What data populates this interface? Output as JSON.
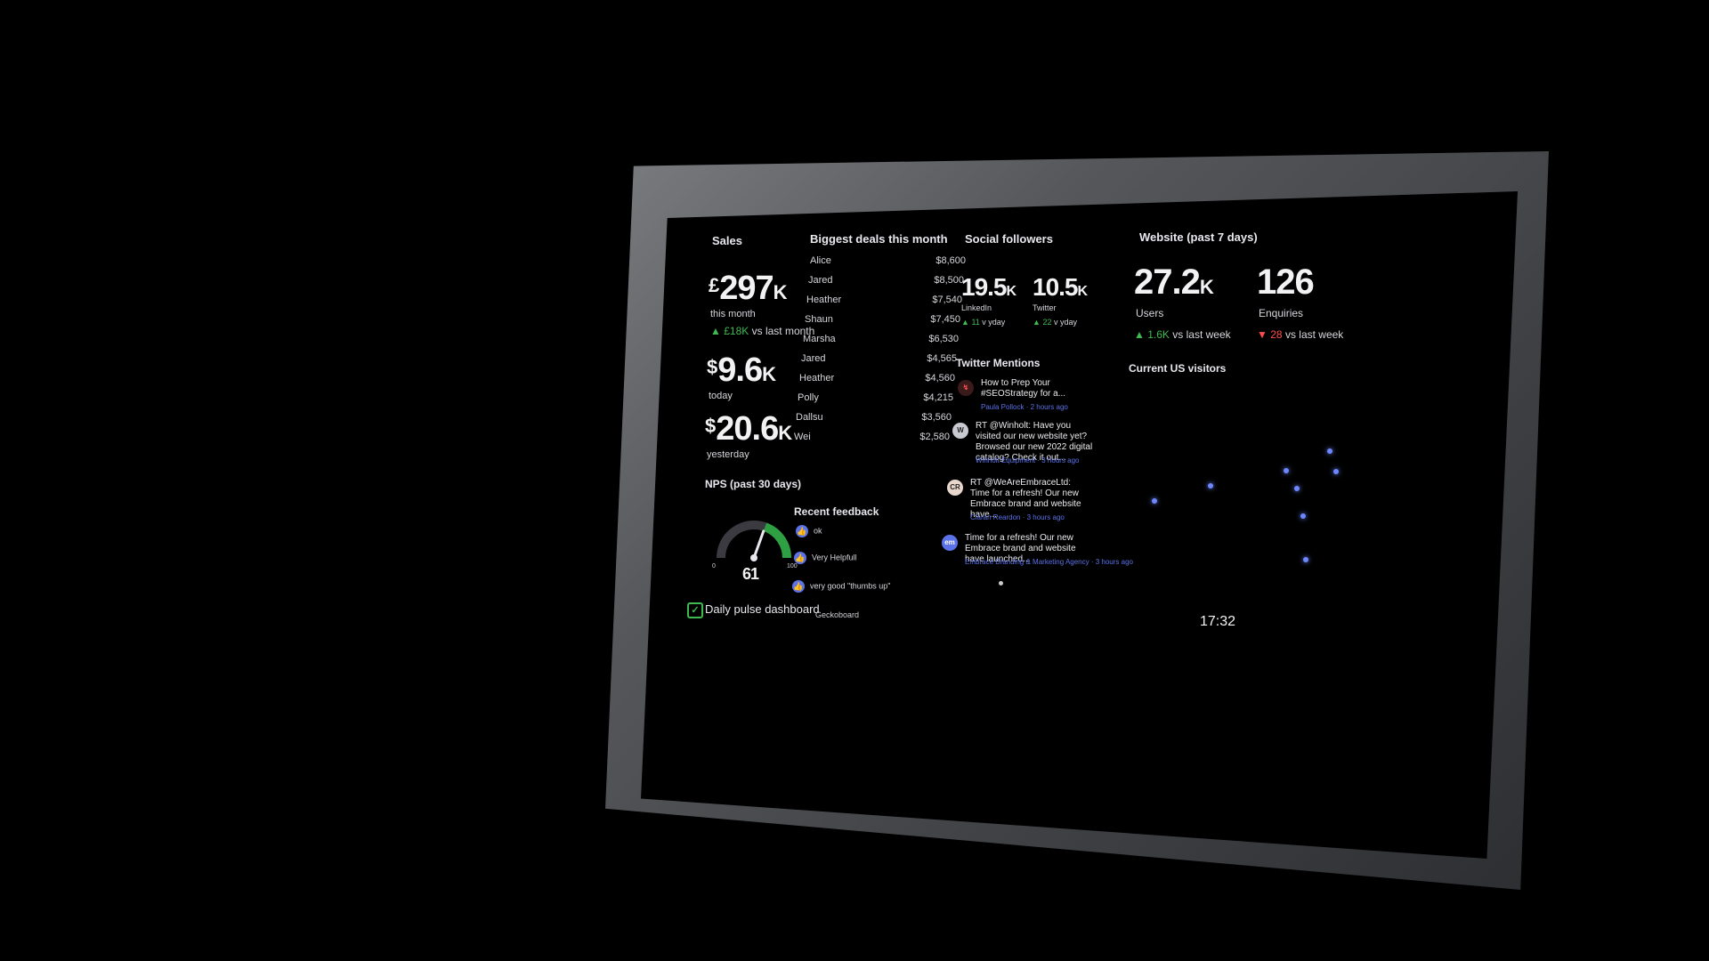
{
  "sales": {
    "title": "Sales",
    "month": {
      "currency": "£",
      "value": "297",
      "unit": "K",
      "label": "this month"
    },
    "month_delta": {
      "value": "£18K",
      "label": "vs last month"
    },
    "today": {
      "currency": "$",
      "value": "9.6",
      "unit": "K",
      "label": "today"
    },
    "yesterday": {
      "currency": "$",
      "value": "20.6",
      "unit": "K",
      "label": "yesterday"
    }
  },
  "nps": {
    "title": "NPS (past 30 days)",
    "value": "61",
    "min": "0",
    "max": "100",
    "level": 0.61
  },
  "deals": {
    "title": "Biggest deals this month",
    "rows": [
      {
        "name": "Alice",
        "value": "$8,600"
      },
      {
        "name": "Jared",
        "value": "$8,500"
      },
      {
        "name": "Heather",
        "value": "$7,540"
      },
      {
        "name": "Shaun",
        "value": "$7,450"
      },
      {
        "name": "Marsha",
        "value": "$6,530"
      },
      {
        "name": "Jared",
        "value": "$4,565"
      },
      {
        "name": "Heather",
        "value": "$4,560"
      },
      {
        "name": "Polly",
        "value": "$4,215"
      },
      {
        "name": "Dallsu",
        "value": "$3,560"
      },
      {
        "name": "Wei",
        "value": "$2,580"
      }
    ]
  },
  "feedback": {
    "title": "Recent feedback",
    "items": [
      "ok",
      "Very Helpfull",
      "very good \"thumbs up\""
    ]
  },
  "social": {
    "title": "Social followers",
    "linkedin": {
      "value": "19.5",
      "unit": "K",
      "label": "LinkedIn",
      "delta": "11",
      "delta_label": "v yday"
    },
    "twitter": {
      "value": "10.5",
      "unit": "K",
      "label": "Twitter",
      "delta": "22",
      "delta_label": "v yday"
    }
  },
  "mentions": {
    "title": "Twitter Mentions",
    "tweets": [
      {
        "text": "How to Prep Your #SEOStrategy for a...",
        "meta": "Paula Pollock · 2 hours ago"
      },
      {
        "text": "RT @Winholt: Have you visited our new website yet? Browsed our new 2022 digital catalog? Check it out...",
        "meta": "Winholt Equipment · 3 hours ago"
      },
      {
        "text": "RT @WeAreEmbraceLtd: Time for a refresh! Our new Embrace brand and website have...",
        "meta": "Ciaran Reardon · 3 hours ago"
      },
      {
        "text": "Time for a refresh! Our new Embrace brand and website have launched...",
        "meta": "Embrace Branding & Marketing Agency · 3 hours ago",
        "avatar": "em"
      }
    ]
  },
  "website": {
    "title": "Website (past 7 days)",
    "users": {
      "value": "27.2",
      "unit": "K",
      "label": "Users",
      "delta": "1.6K",
      "delta_label": "vs last week"
    },
    "enquiries": {
      "value": "126",
      "label": "Enquiries",
      "delta": "28",
      "delta_label": "vs last week"
    }
  },
  "visitors": {
    "title": "Current US visitors"
  },
  "footer": {
    "dashboard_name": "Daily pulse dashboard",
    "brand": "Geckoboard",
    "clock": "17:32"
  },
  "colors": {
    "up": "#3fb950",
    "down": "#ff4d4d",
    "accent": "#5b72e8",
    "gauge": "#2ea043"
  }
}
